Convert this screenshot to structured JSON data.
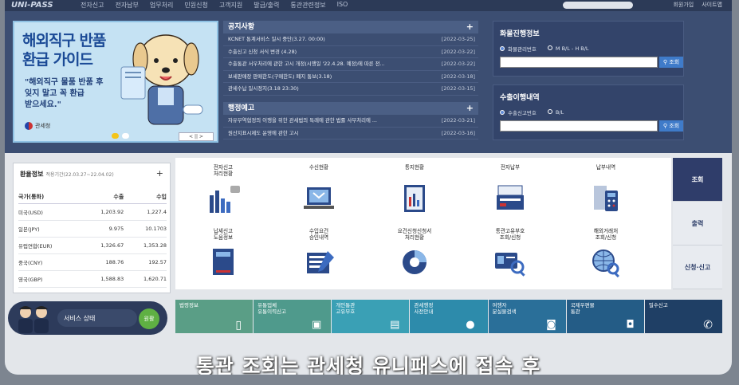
{
  "header": {
    "logo": "UNI-PASS",
    "menu": [
      "전자신고",
      "전자납부",
      "업무처리",
      "민원신청",
      "고객지원",
      "발급/출력",
      "통관관련정보",
      "ISO"
    ],
    "utils": [
      "회원가입",
      "사이트맵"
    ]
  },
  "banner": {
    "line1": "해외직구 반품",
    "line2": "환급 가이드",
    "line3": "\"해외직구 물품 반품 후",
    "line4": "잊지 말고 꼭 환급",
    "line5": "받으세요.\"",
    "org": "관세청",
    "pager": "< || >"
  },
  "notices": {
    "title": "공지사항",
    "items": [
      {
        "text": "KCNET 통계서비스 일시 중단(3.27. 00:00)",
        "date": "[2022-03-25]"
      },
      {
        "text": "수출신고 신청 서식 변경 (4.28)",
        "date": "[2022-03-22]"
      },
      {
        "text": "수출통관 서우처리에 관한 고시 개정(시행일 '22.4.28. 예정)에 따른 전...",
        "date": "[2022-03-22]"
      },
      {
        "text": "보세판매장 판매한도(구매한도) 폐지 통보(3.18)",
        "date": "[2022-03-18]"
      },
      {
        "text": "관세수납 일시정지(3.18 23:30)",
        "date": "[2022-03-15]"
      }
    ]
  },
  "admin": {
    "title": "행정예고",
    "items": [
      {
        "text": "자유무역협정의 이행을 위한 관세법의 특례에 관한 법률 사무처리에 ...",
        "date": "[2022-03-21]"
      },
      {
        "text": "원산지표시제도 운영에 관한 고시",
        "date": "[2022-03-16]"
      }
    ]
  },
  "cargo": {
    "title": "화물진행정보",
    "radio1": "화물관리번호",
    "radio2": "M B/L - H B/L",
    "button": "조회"
  },
  "export": {
    "title": "수출이행내역",
    "radio1": "수출신고번호",
    "radio2": "B/L",
    "button": "조회"
  },
  "fx": {
    "title": "환율정보",
    "period": "적용기간(22.03.27~22.04.02)",
    "headers": [
      "국가(통화)",
      "수출",
      "수입"
    ],
    "rows": [
      [
        "미국(USD)",
        "1,203.92",
        "1,227.4"
      ],
      [
        "일본(JPY)",
        "9.975",
        "10.1703"
      ],
      [
        "유럽연합(EUR)",
        "1,326.67",
        "1,353.28"
      ],
      [
        "중국(CNY)",
        "188.76",
        "192.57"
      ],
      [
        "영국(GBP)",
        "1,588.83",
        "1,620.71"
      ]
    ]
  },
  "service_status": {
    "label": "서비스 상태",
    "button": "원활"
  },
  "services": [
    {
      "l1": "전자신고",
      "l2": "처리현황",
      "icon": "bar-chart-icon"
    },
    {
      "l1": "수신현황",
      "l2": "",
      "icon": "laptop-mail-icon"
    },
    {
      "l1": "통지현황",
      "l2": "",
      "icon": "document-chart-icon"
    },
    {
      "l1": "전자납부",
      "l2": "",
      "icon": "payment-terminal-icon"
    },
    {
      "l1": "납부내역",
      "l2": "",
      "icon": "calculator-icon"
    },
    {
      "l1": "납세신고",
      "l2": "도움정보",
      "icon": "help-book-icon"
    },
    {
      "l1": "수입요건",
      "l2": "승인내역",
      "icon": "approval-icon"
    },
    {
      "l1": "요건신청신청서",
      "l2": "처리현황",
      "icon": "progress-icon"
    },
    {
      "l1": "통관고유부호",
      "l2": "조회/신청",
      "icon": "id-search-icon"
    },
    {
      "l1": "해외거래처",
      "l2": "조회/신청",
      "icon": "globe-search-icon"
    }
  ],
  "side_tabs": [
    "조회",
    "출력",
    "신청·신고"
  ],
  "tiles": [
    {
      "l1": "법령정보",
      "l2": "",
      "color": "#5a9e86"
    },
    {
      "l1": "유통업체",
      "l2": "유통이력신고",
      "color": "#4f9a8c"
    },
    {
      "l1": "개인통관",
      "l2": "고유부호",
      "color": "#3aa0b5"
    },
    {
      "l1": "관세행정",
      "l2": "사전안내",
      "color": "#2d8bab"
    },
    {
      "l1": "여행자",
      "l2": "분실물검색",
      "color": "#2a6f99"
    },
    {
      "l1": "국제우편물",
      "l2": "통관",
      "color": "#245c86"
    },
    {
      "l1": "밀수신고",
      "l2": "",
      "color": "#1f3f65"
    }
  ],
  "subtitle": "통관 조회는 관세청 유니패스에 접속 후"
}
